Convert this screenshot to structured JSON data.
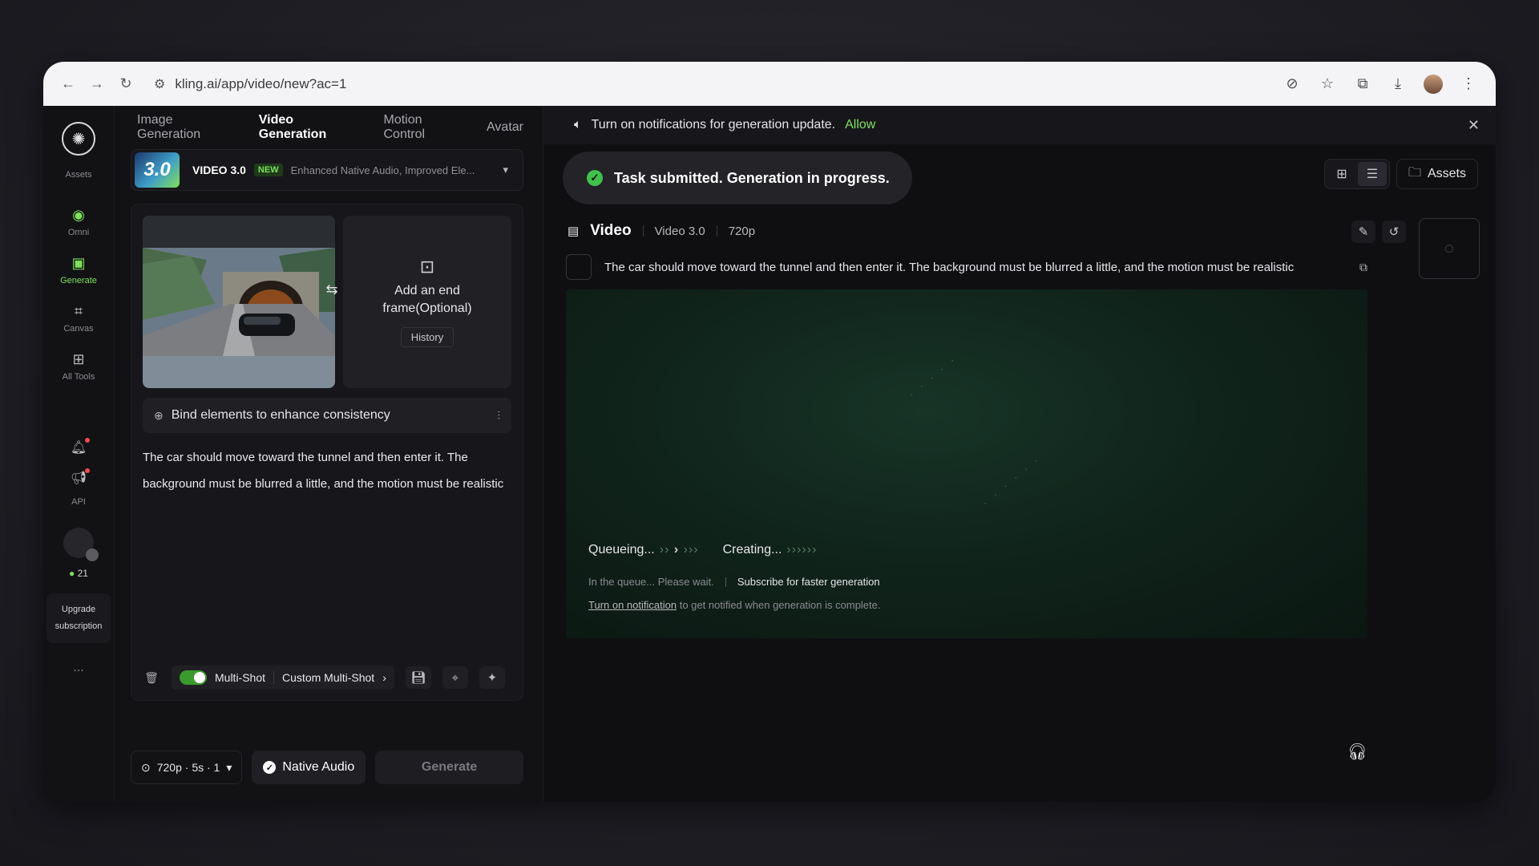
{
  "browser": {
    "url": "kling.ai/app/video/new?ac=1"
  },
  "rail": {
    "assets_label": "Assets",
    "items": [
      {
        "label": "Omni"
      },
      {
        "label": "Generate"
      },
      {
        "label": "Canvas"
      },
      {
        "label": "All Tools"
      }
    ],
    "api_label": "API",
    "credits": "21",
    "upgrade_line1": "Upgrade",
    "upgrade_line2": "subscription",
    "more": "..."
  },
  "tabs": [
    "Image Generation",
    "Video Generation",
    "Motion Control",
    "Avatar"
  ],
  "model": {
    "badge_text": "3.0",
    "name": "VIDEO 3.0",
    "new_label": "NEW",
    "description": "Enhanced Native Audio, Improved Ele..."
  },
  "frames": {
    "end_frame_label": "Add an end frame(Optional)",
    "history_label": "History"
  },
  "bind": {
    "label": "Bind elements to enhance consistency"
  },
  "prompt_text": "The car should move toward the tunnel and then enter it. The background must be blurred a little, and the motion must be realistic",
  "card_footer": {
    "multishot_label": "Multi-Shot",
    "custom_label": "Custom Multi-Shot"
  },
  "bottom": {
    "settings_label": "720p · 5s · 1",
    "audio_label": "Native Audio",
    "generate_label": "Generate"
  },
  "notification": {
    "text": "Turn on notifications for generation update.",
    "allow": "Allow"
  },
  "toast": {
    "text": "Task submitted. Generation in progress."
  },
  "view": {
    "assets_label": "Assets"
  },
  "result": {
    "title": "Video",
    "model": "Video 3.0",
    "resolution": "720p",
    "prompt": "The car should move toward the tunnel and then enter it. The background must be blurred a little, and the motion must be realistic",
    "queueing_label": "Queueing...",
    "creating_label": "Creating...",
    "queue_wait": "In the queue... Please wait.",
    "subscribe": "Subscribe for faster generation",
    "turn_on_link": "Turn on notification",
    "turn_on_rest": "to get notified when generation is complete."
  },
  "colors": {
    "accent_green": "#7de05a",
    "success_green": "#3ec24a",
    "stage_bg": "#10241b"
  }
}
